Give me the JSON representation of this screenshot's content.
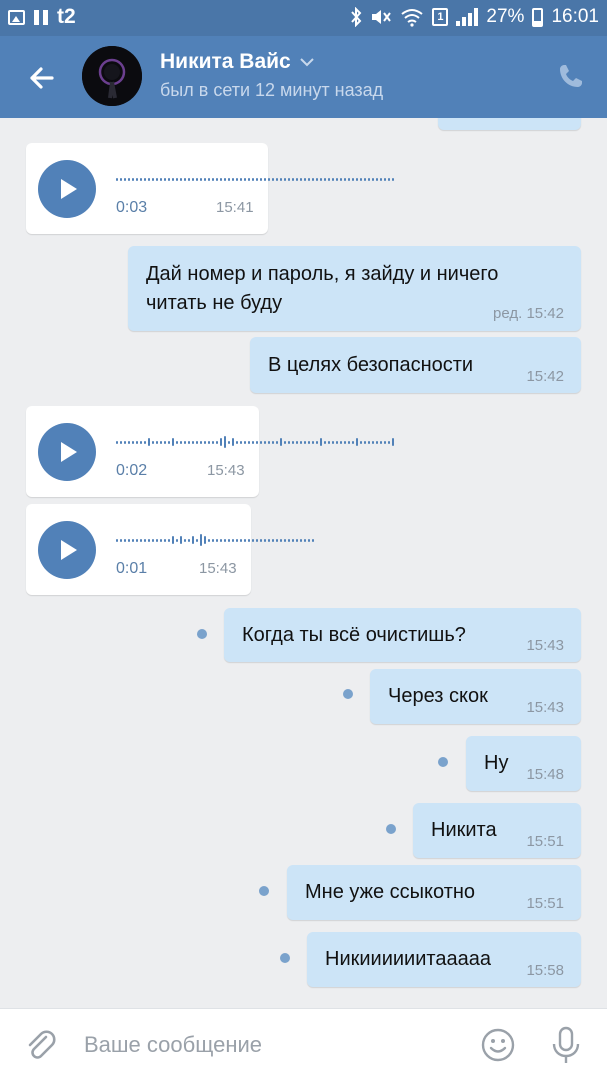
{
  "status_bar": {
    "carrier": "t2",
    "battery": "27%",
    "clock": "16:01",
    "sim_badge": "1",
    "icons": [
      "gallery-icon",
      "pause-icon",
      "bluetooth-icon",
      "mute-icon",
      "wifi-icon",
      "sim-icon",
      "signal-icon",
      "battery-icon"
    ]
  },
  "header": {
    "contact_name": "Никита Вайс",
    "last_seen": "был в сети 12 минут назад",
    "icons": [
      "back-arrow-icon",
      "chevron-down-icon",
      "phone-icon"
    ]
  },
  "messages": [
    {
      "type": "voice",
      "direction": "in",
      "duration": "0:03",
      "time": "15:41"
    },
    {
      "type": "text",
      "direction": "out",
      "lines": [
        "Дай номер и пароль, я зайду и ничего",
        "читать не буду"
      ],
      "time": "ред. 15:42",
      "edited": true
    },
    {
      "type": "text",
      "direction": "out",
      "text": "В целях безопасности",
      "time": "15:42"
    },
    {
      "type": "voice",
      "direction": "in",
      "duration": "0:02",
      "time": "15:43"
    },
    {
      "type": "voice",
      "direction": "in",
      "duration": "0:01",
      "time": "15:43"
    },
    {
      "type": "text",
      "direction": "out",
      "text": "Когда ты всё очистишь?",
      "time": "15:43",
      "unread": true
    },
    {
      "type": "text",
      "direction": "out",
      "text": "Через скок",
      "time": "15:43",
      "unread": true
    },
    {
      "type": "text",
      "direction": "out",
      "text": "Ну",
      "time": "15:48",
      "unread": true
    },
    {
      "type": "text",
      "direction": "out",
      "text": "Никита",
      "time": "15:51",
      "unread": true
    },
    {
      "type": "text",
      "direction": "out",
      "text": "Мне уже ссыкотно",
      "time": "15:51",
      "unread": true
    },
    {
      "type": "text",
      "direction": "out",
      "text": "Никиииииитааааа",
      "time": "15:58",
      "unread": true
    }
  ],
  "composer": {
    "placeholder": "Ваше сообщение",
    "value": "",
    "icons": [
      "paperclip-icon",
      "smile-icon",
      "microphone-icon"
    ]
  },
  "colors": {
    "header": "#5181b8",
    "status_bar": "#4a76a8",
    "background": "#edeef0",
    "outgoing_bubble": "#cce4f7",
    "incoming_bubble": "#ffffff",
    "accent": "#5181b8"
  }
}
